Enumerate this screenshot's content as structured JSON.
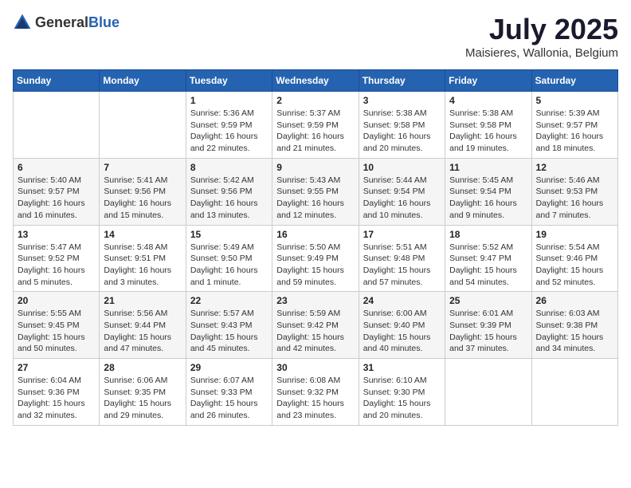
{
  "logo": {
    "general": "General",
    "blue": "Blue"
  },
  "title": "July 2025",
  "location": "Maisieres, Wallonia, Belgium",
  "days_of_week": [
    "Sunday",
    "Monday",
    "Tuesday",
    "Wednesday",
    "Thursday",
    "Friday",
    "Saturday"
  ],
  "weeks": [
    [
      {
        "day": "",
        "info": ""
      },
      {
        "day": "",
        "info": ""
      },
      {
        "day": "1",
        "info": "Sunrise: 5:36 AM\nSunset: 9:59 PM\nDaylight: 16 hours and 22 minutes."
      },
      {
        "day": "2",
        "info": "Sunrise: 5:37 AM\nSunset: 9:59 PM\nDaylight: 16 hours and 21 minutes."
      },
      {
        "day": "3",
        "info": "Sunrise: 5:38 AM\nSunset: 9:58 PM\nDaylight: 16 hours and 20 minutes."
      },
      {
        "day": "4",
        "info": "Sunrise: 5:38 AM\nSunset: 9:58 PM\nDaylight: 16 hours and 19 minutes."
      },
      {
        "day": "5",
        "info": "Sunrise: 5:39 AM\nSunset: 9:57 PM\nDaylight: 16 hours and 18 minutes."
      }
    ],
    [
      {
        "day": "6",
        "info": "Sunrise: 5:40 AM\nSunset: 9:57 PM\nDaylight: 16 hours and 16 minutes."
      },
      {
        "day": "7",
        "info": "Sunrise: 5:41 AM\nSunset: 9:56 PM\nDaylight: 16 hours and 15 minutes."
      },
      {
        "day": "8",
        "info": "Sunrise: 5:42 AM\nSunset: 9:56 PM\nDaylight: 16 hours and 13 minutes."
      },
      {
        "day": "9",
        "info": "Sunrise: 5:43 AM\nSunset: 9:55 PM\nDaylight: 16 hours and 12 minutes."
      },
      {
        "day": "10",
        "info": "Sunrise: 5:44 AM\nSunset: 9:54 PM\nDaylight: 16 hours and 10 minutes."
      },
      {
        "day": "11",
        "info": "Sunrise: 5:45 AM\nSunset: 9:54 PM\nDaylight: 16 hours and 9 minutes."
      },
      {
        "day": "12",
        "info": "Sunrise: 5:46 AM\nSunset: 9:53 PM\nDaylight: 16 hours and 7 minutes."
      }
    ],
    [
      {
        "day": "13",
        "info": "Sunrise: 5:47 AM\nSunset: 9:52 PM\nDaylight: 16 hours and 5 minutes."
      },
      {
        "day": "14",
        "info": "Sunrise: 5:48 AM\nSunset: 9:51 PM\nDaylight: 16 hours and 3 minutes."
      },
      {
        "day": "15",
        "info": "Sunrise: 5:49 AM\nSunset: 9:50 PM\nDaylight: 16 hours and 1 minute."
      },
      {
        "day": "16",
        "info": "Sunrise: 5:50 AM\nSunset: 9:49 PM\nDaylight: 15 hours and 59 minutes."
      },
      {
        "day": "17",
        "info": "Sunrise: 5:51 AM\nSunset: 9:48 PM\nDaylight: 15 hours and 57 minutes."
      },
      {
        "day": "18",
        "info": "Sunrise: 5:52 AM\nSunset: 9:47 PM\nDaylight: 15 hours and 54 minutes."
      },
      {
        "day": "19",
        "info": "Sunrise: 5:54 AM\nSunset: 9:46 PM\nDaylight: 15 hours and 52 minutes."
      }
    ],
    [
      {
        "day": "20",
        "info": "Sunrise: 5:55 AM\nSunset: 9:45 PM\nDaylight: 15 hours and 50 minutes."
      },
      {
        "day": "21",
        "info": "Sunrise: 5:56 AM\nSunset: 9:44 PM\nDaylight: 15 hours and 47 minutes."
      },
      {
        "day": "22",
        "info": "Sunrise: 5:57 AM\nSunset: 9:43 PM\nDaylight: 15 hours and 45 minutes."
      },
      {
        "day": "23",
        "info": "Sunrise: 5:59 AM\nSunset: 9:42 PM\nDaylight: 15 hours and 42 minutes."
      },
      {
        "day": "24",
        "info": "Sunrise: 6:00 AM\nSunset: 9:40 PM\nDaylight: 15 hours and 40 minutes."
      },
      {
        "day": "25",
        "info": "Sunrise: 6:01 AM\nSunset: 9:39 PM\nDaylight: 15 hours and 37 minutes."
      },
      {
        "day": "26",
        "info": "Sunrise: 6:03 AM\nSunset: 9:38 PM\nDaylight: 15 hours and 34 minutes."
      }
    ],
    [
      {
        "day": "27",
        "info": "Sunrise: 6:04 AM\nSunset: 9:36 PM\nDaylight: 15 hours and 32 minutes."
      },
      {
        "day": "28",
        "info": "Sunrise: 6:06 AM\nSunset: 9:35 PM\nDaylight: 15 hours and 29 minutes."
      },
      {
        "day": "29",
        "info": "Sunrise: 6:07 AM\nSunset: 9:33 PM\nDaylight: 15 hours and 26 minutes."
      },
      {
        "day": "30",
        "info": "Sunrise: 6:08 AM\nSunset: 9:32 PM\nDaylight: 15 hours and 23 minutes."
      },
      {
        "day": "31",
        "info": "Sunrise: 6:10 AM\nSunset: 9:30 PM\nDaylight: 15 hours and 20 minutes."
      },
      {
        "day": "",
        "info": ""
      },
      {
        "day": "",
        "info": ""
      }
    ]
  ]
}
